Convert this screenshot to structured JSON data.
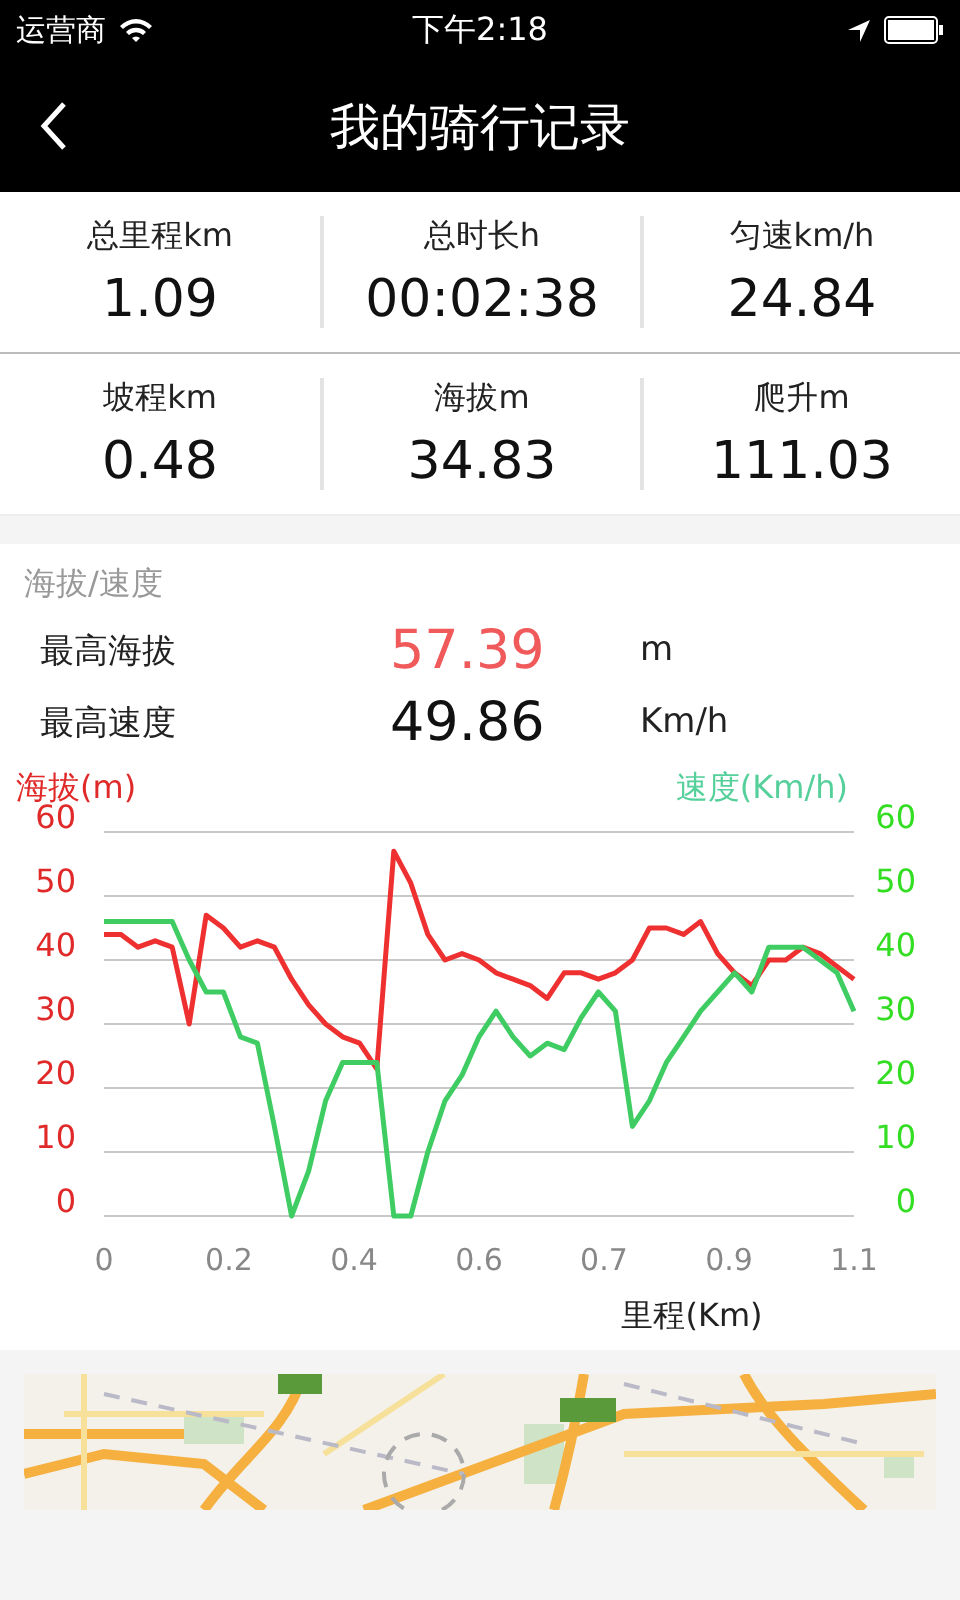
{
  "status_bar": {
    "carrier": "运营商",
    "time": "下午2:18"
  },
  "nav": {
    "title": "我的骑行记录"
  },
  "stats": [
    [
      {
        "label": "总里程km",
        "value": "1.09"
      },
      {
        "label": "总时长h",
        "value": "00:02:38"
      },
      {
        "label": "匀速km/h",
        "value": "24.84"
      }
    ],
    [
      {
        "label": "坡程km",
        "value": "0.48"
      },
      {
        "label": "海拔m",
        "value": "34.83"
      },
      {
        "label": "爬升m",
        "value": "111.03"
      }
    ]
  ],
  "section": {
    "title": "海拔/速度",
    "highlights": [
      {
        "label": "最高海拔",
        "value": "57.39",
        "unit": "m",
        "color": "#f05a5a"
      },
      {
        "label": "最高速度",
        "value": "49.86",
        "unit": "Km/h",
        "color": "#111111"
      }
    ],
    "chart_data": {
      "type": "line",
      "xlabel": "里程(Km)",
      "ylabel": "海拔(m)",
      "y2label": "速度(Km/h)",
      "xlim": [
        0,
        1.1
      ],
      "ylim": [
        0,
        60
      ],
      "y2lim": [
        0,
        60
      ],
      "grid": true,
      "x": [
        0,
        0.025,
        0.05,
        0.075,
        0.1,
        0.125,
        0.15,
        0.175,
        0.2,
        0.225,
        0.25,
        0.275,
        0.3,
        0.325,
        0.35,
        0.375,
        0.4,
        0.425,
        0.45,
        0.475,
        0.5,
        0.525,
        0.55,
        0.575,
        0.6,
        0.625,
        0.65,
        0.675,
        0.7,
        0.725,
        0.75,
        0.775,
        0.8,
        0.825,
        0.85,
        0.875,
        0.9,
        0.925,
        0.95,
        0.975,
        1.0,
        1.025,
        1.05,
        1.075,
        1.1
      ],
      "xticks": [
        {
          "value": 0,
          "label": "0"
        },
        {
          "value": 0.1833,
          "label": "0.2"
        },
        {
          "value": 0.3667,
          "label": "0.4"
        },
        {
          "value": 0.55,
          "label": "0.6"
        },
        {
          "value": 0.7333,
          "label": "0.7"
        },
        {
          "value": 0.9167,
          "label": "0.9"
        },
        {
          "value": 1.1,
          "label": "1.1"
        }
      ],
      "yticks": [
        0,
        10,
        20,
        30,
        40,
        50,
        60
      ],
      "y2ticks": [
        0,
        10,
        20,
        30,
        40,
        50,
        60
      ],
      "series": [
        {
          "color": "#ee3030",
          "values": [
            44,
            44,
            42,
            43,
            42,
            30,
            47,
            45,
            42,
            43,
            42,
            37,
            33,
            30,
            28,
            27,
            23,
            57,
            52,
            44,
            40,
            41,
            40,
            38,
            37,
            36,
            34,
            38,
            38,
            37,
            38,
            40,
            45,
            45,
            44,
            46,
            41,
            38,
            36,
            40,
            40,
            42,
            41,
            39,
            37
          ]
        },
        {
          "color": "#3fcc62",
          "values": [
            46,
            46,
            46,
            46,
            46,
            40,
            35,
            35,
            28,
            27,
            14,
            0,
            7,
            18,
            24,
            24,
            24,
            0,
            0,
            10,
            18,
            22,
            28,
            32,
            28,
            25,
            27,
            26,
            31,
            35,
            32,
            14,
            18,
            24,
            28,
            32,
            35,
            38,
            35,
            42,
            42,
            42,
            40,
            38,
            32
          ]
        }
      ]
    }
  }
}
